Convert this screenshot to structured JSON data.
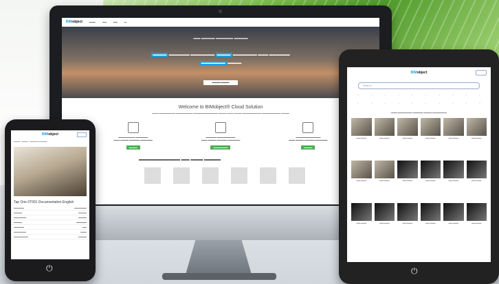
{
  "site": {
    "logo_prefix": "BIM",
    "logo_main": "object"
  },
  "monitor": {
    "welcome": "Welcome to BIMobject® Cloud Solution"
  },
  "tablet": {
    "search_placeholder": "Search"
  },
  "phone": {
    "title": "Tap Orie 0T001 Documentation English"
  },
  "colors": {
    "accent": "#1aa1e0",
    "green": "#4caf50",
    "device": "#1b1d20"
  },
  "icons": {
    "home": "power-button-icon"
  }
}
